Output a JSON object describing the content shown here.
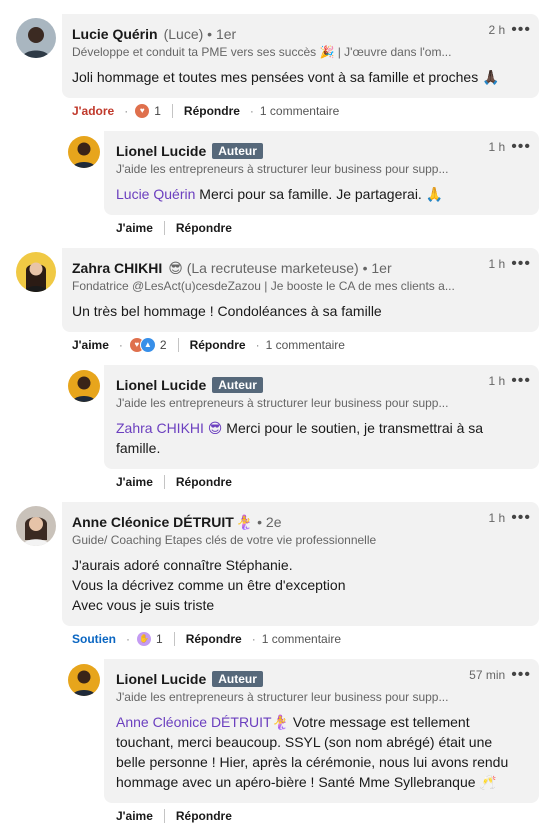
{
  "comments": [
    {
      "name": "Lucie Quérin",
      "pseudo": "(Luce)",
      "degree": "• 1er",
      "headline": "Développe et conduit ta PME vers ses succès 🎉 | J'œuvre dans l'om...",
      "time": "2 h",
      "text": "Joli hommage et toutes mes pensées vont à sa famille et proches 🙏🏿",
      "reaction_label": "J'adore",
      "reaction_count": "1",
      "reply_label": "Répondre",
      "comment_count": "1 commentaire",
      "reply": {
        "name": "Lionel Lucide",
        "badge": "Auteur",
        "headline": "J'aide les entrepreneurs à structurer leur business pour supp...",
        "time": "1 h",
        "mention": "Lucie Quérin",
        "text": " Merci pour sa famille. Je partagerai. 🙏",
        "like_label": "J'aime",
        "reply_label": "Répondre"
      }
    },
    {
      "name": "Zahra CHIKHI",
      "pseudo": "😎  (La recruteuse marketeuse)",
      "degree": "• 1er",
      "headline": "Fondatrice @LesAct(u)cesdeZazou | Je booste le CA de mes clients a...",
      "time": "1 h",
      "text": "Un très bel hommage ! Condoléances à sa famille",
      "reaction_label": "J'aime",
      "reaction_count": "2",
      "reply_label": "Répondre",
      "comment_count": "1 commentaire",
      "reply": {
        "name": "Lionel Lucide",
        "badge": "Auteur",
        "headline": "J'aide les entrepreneurs à structurer leur business pour supp...",
        "time": "1 h",
        "mention": "Zahra CHIKHI 😎",
        "text_lines": [
          " Merci pour le soutien, je transmettrai à sa",
          "famille."
        ],
        "like_label": "J'aime",
        "reply_label": "Répondre"
      }
    },
    {
      "name": "Anne Cléonice DÉTRUIT",
      "pseudo": "🧜‍♀️",
      "degree": "• 2e",
      "headline": "Guide/ Coaching Etapes clés de votre vie professionnelle",
      "time": "1 h",
      "text_lines": [
        "J'aurais adoré connaître Stéphanie.",
        "Vous la décrivez comme un être d'exception",
        "Avec vous je suis triste"
      ],
      "reaction_label": "Soutien",
      "reaction_count": "1",
      "reply_label": "Répondre",
      "comment_count": "1 commentaire",
      "reply": {
        "name": "Lionel Lucide",
        "badge": "Auteur",
        "headline": "J'aide les entrepreneurs à structurer leur business pour supp...",
        "time": "57 min",
        "mention": "Anne Cléonice DÉTRUIT🧜‍♀️",
        "text_lines": [
          " Votre message est tellement",
          "touchant, merci beaucoup. SSYL (son nom abrégé) était une",
          "belle personne ! Hier, après la cérémonie, nous lui avons rendu",
          "hommage avec un apéro-bière ! Santé Mme Syllebranque 🥂"
        ],
        "like_label": "J'aime",
        "reply_label": "Répondre"
      }
    }
  ],
  "more_icon": "•••",
  "colors": {
    "mention": "#6b3fbf",
    "love": "#c0392b",
    "support": "#0a66c2",
    "badge": "#56687a"
  }
}
